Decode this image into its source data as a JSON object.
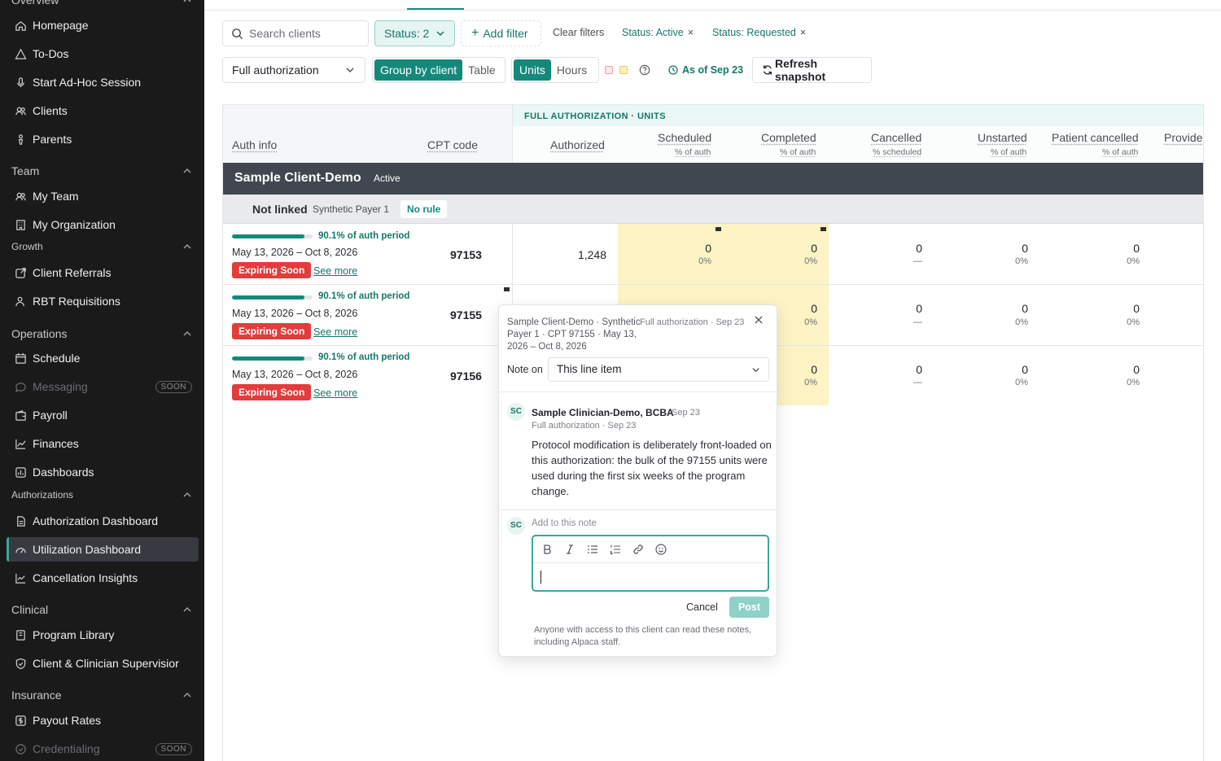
{
  "sidebar": {
    "overview_title": "Overview",
    "items_overview": [
      "Homepage",
      "To-Dos",
      "Start Ad-Hoc Session",
      "Clients",
      "Parents"
    ],
    "team_title": "Team",
    "items_team": [
      "My Team",
      "My Organization"
    ],
    "growth_title": "Growth",
    "items_growth": [
      "Client Referrals",
      "RBT Requisitions"
    ],
    "operations_title": "Operations",
    "items_operations": [
      "Schedule",
      "Messaging",
      "Payroll",
      "Finances",
      "Dashboards"
    ],
    "soon_label": "SOON",
    "authorizations_title": "Authorizations",
    "items_authorizations": [
      "Authorization Dashboard",
      "Utilization Dashboard",
      "Cancellation Insights"
    ],
    "clinical_title": "Clinical",
    "items_clinical": [
      "Program Library",
      "Client & Clinician Supervisior"
    ],
    "insurance_title": "Insurance",
    "items_insurance": [
      "Payout Rates",
      "Credentialing"
    ]
  },
  "toolbar": {
    "search_placeholder": "Search clients",
    "status_label": "Status: 2",
    "add_filter_label": "Add filter",
    "clear_filters_label": "Clear filters",
    "chip_active": "Status: Active",
    "chip_requested": "Status: Requested",
    "chip_remove": "×",
    "auth_select": "Full authorization",
    "group_by_client": "Group by client",
    "table_label": "Table",
    "units_label": "Units",
    "hours_label": "Hours",
    "as_of": "As of Sep 23",
    "refresh_label": "Refresh snapshot"
  },
  "table": {
    "band_label": "FULL AUTHORIZATION · UNITS",
    "headers": {
      "auth_info": "Auth info",
      "cpt_code": "CPT code",
      "authorized": "Authorized",
      "scheduled": "Scheduled",
      "scheduled_sub": "% of auth",
      "completed": "Completed",
      "completed_sub": "% of auth",
      "cancelled": "Cancelled",
      "cancelled_sub": "% scheduled",
      "unstarted": "Unstarted",
      "unstarted_sub": "% of auth",
      "patient_cancelled": "Patient cancelled",
      "patient_cancelled_sub": "% of auth",
      "provider": "Provide"
    },
    "client": {
      "name": "Sample Client-Demo",
      "status": "Active"
    },
    "payer": {
      "link_status": "Not linked",
      "name": "Synthetic Payer 1",
      "rule": "No rule"
    },
    "rows": [
      {
        "progress_pct": 90.1,
        "progress_label": "90.1% of auth period",
        "dates": "May 13, 2026 – Oct 8, 2026",
        "badge": "Expiring Soon",
        "see_more": "See more",
        "cpt": "97153",
        "authorized": "1,248",
        "scheduled": "0",
        "scheduled_pct": "0%",
        "completed": "0",
        "completed_pct": "0%",
        "cancelled": "0",
        "cancelled_pct": "—",
        "unstarted": "0",
        "unstarted_pct": "0%",
        "patient_cancelled": "0",
        "patient_cancelled_pct": "0%"
      },
      {
        "progress_pct": 90.1,
        "progress_label": "90.1% of auth period",
        "dates": "May 13, 2026 – Oct 8, 2026",
        "badge": "Expiring Soon",
        "see_more": "See more",
        "cpt": "97155",
        "completed": "0",
        "completed_pct": "0%",
        "cancelled": "0",
        "cancelled_pct": "—",
        "unstarted": "0",
        "unstarted_pct": "0%",
        "patient_cancelled": "0",
        "patient_cancelled_pct": "0%"
      },
      {
        "progress_pct": 90.1,
        "progress_label": "90.1% of auth period",
        "dates": "May 13, 2026 – Oct 8, 2026",
        "badge": "Expiring Soon",
        "see_more": "See more",
        "cpt": "97156",
        "completed": "0",
        "completed_pct": "0%",
        "cancelled": "0",
        "cancelled_pct": "—",
        "unstarted": "0",
        "unstarted_pct": "0%",
        "patient_cancelled": "0",
        "patient_cancelled_pct": "0%"
      }
    ]
  },
  "note_popover": {
    "context": "Sample Client-Demo · Synthetic Payer 1 · CPT 97155 · May 13, 2026 – Oct 8, 2026",
    "meta": "Full authorization · Sep 23",
    "close": "×",
    "note_on_label": "Note on",
    "note_on_value": "This line item",
    "author_initials": "SC",
    "author": "Sample Clinician-Demo, BCBA",
    "author_date": "Sep 23",
    "author_context": "Full authorization · Sep 23",
    "body": "Protocol modification is deliberately front-loaded on this authorization: the bulk of the 97155 units were used during the first six weeks of the program change.",
    "add_placeholder": "Add to this note",
    "cancel_label": "Cancel",
    "post_label": "Post",
    "footer": "Anyone with access to this client can read these notes, including Alpaca staff."
  },
  "colors": {
    "accent": "#14897b",
    "danger": "#e23c3c",
    "highlight": "#fdf3c4",
    "sidebar_bg": "#1a1a1b"
  }
}
